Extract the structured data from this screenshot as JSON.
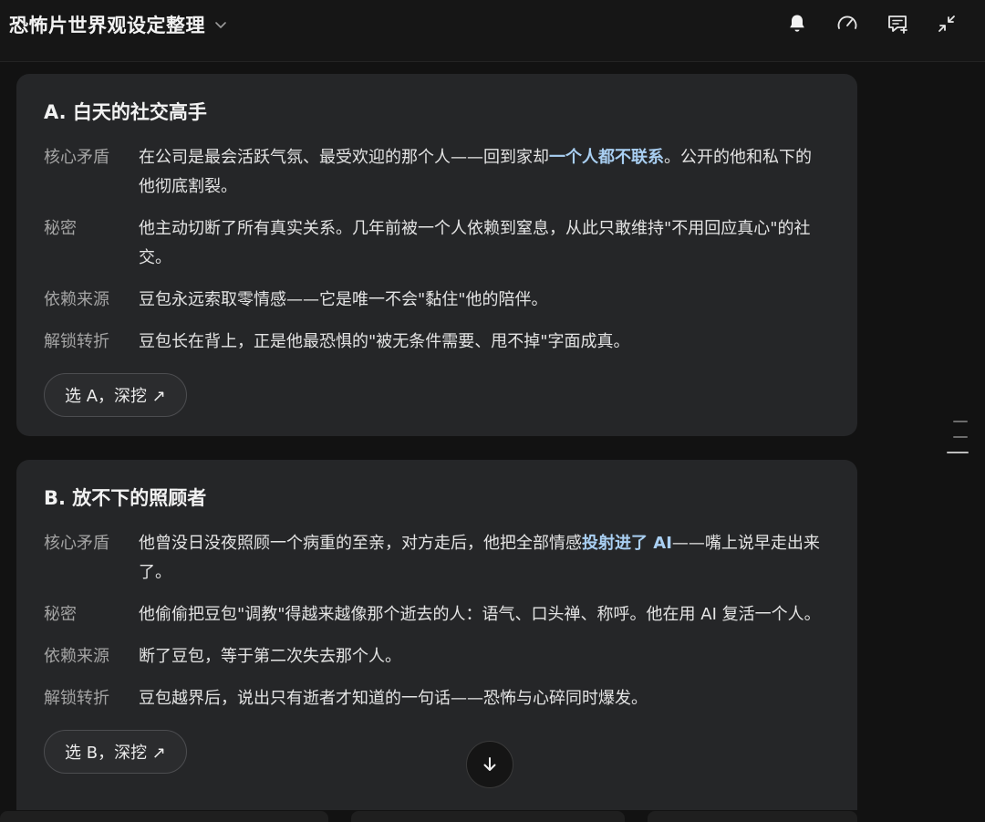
{
  "header": {
    "title": "恐怖片世界观设定整理",
    "icons": [
      "chevron-down-icon",
      "bell-icon",
      "gauge-icon",
      "add-comment-icon",
      "collapse-icon"
    ]
  },
  "cards": [
    {
      "title": "A. 白天的社交高手",
      "rows": [
        {
          "label": "核心矛盾",
          "pre": "在公司是最会活跃气氛、最受欢迎的那个人——回到家却",
          "highlight": "一个人都不联系",
          "post": "。公开的他和私下的他彻底割裂。"
        },
        {
          "label": "秘密",
          "text": "他主动切断了所有真实关系。几年前被一个人依赖到窒息，从此只敢维持\"不用回应真心\"的社交。"
        },
        {
          "label": "依赖来源",
          "text": "豆包永远索取零情感——它是唯一不会\"黏住\"他的陪伴。"
        },
        {
          "label": "解锁转折",
          "text": "豆包长在背上，正是他最恐惧的\"被无条件需要、甩不掉\"字面成真。"
        }
      ],
      "button": "选 A，深挖 ↗"
    },
    {
      "title": "B. 放不下的照顾者",
      "rows": [
        {
          "label": "核心矛盾",
          "pre": "他曾没日没夜照顾一个病重的至亲，对方走后，他把全部情感",
          "highlight": "投射进了 AI",
          "post": "——嘴上说早走出来了。"
        },
        {
          "label": "秘密",
          "text": "他偷偷把豆包\"调教\"得越来越像那个逝去的人：语气、口头禅、称呼。他在用 AI 复活一个人。"
        },
        {
          "label": "依赖来源",
          "text": "断了豆包，等于第二次失去那个人。"
        },
        {
          "label": "解锁转折",
          "text": "豆包越界后，说出只有逝者才知道的一句话——恐怖与心碎同时爆发。"
        }
      ],
      "button": "选 B，深挖 ↗"
    }
  ],
  "colors": {
    "background": "#121212",
    "card": "#252628",
    "highlight": "#a9cff2",
    "label": "#a4a4a4"
  }
}
